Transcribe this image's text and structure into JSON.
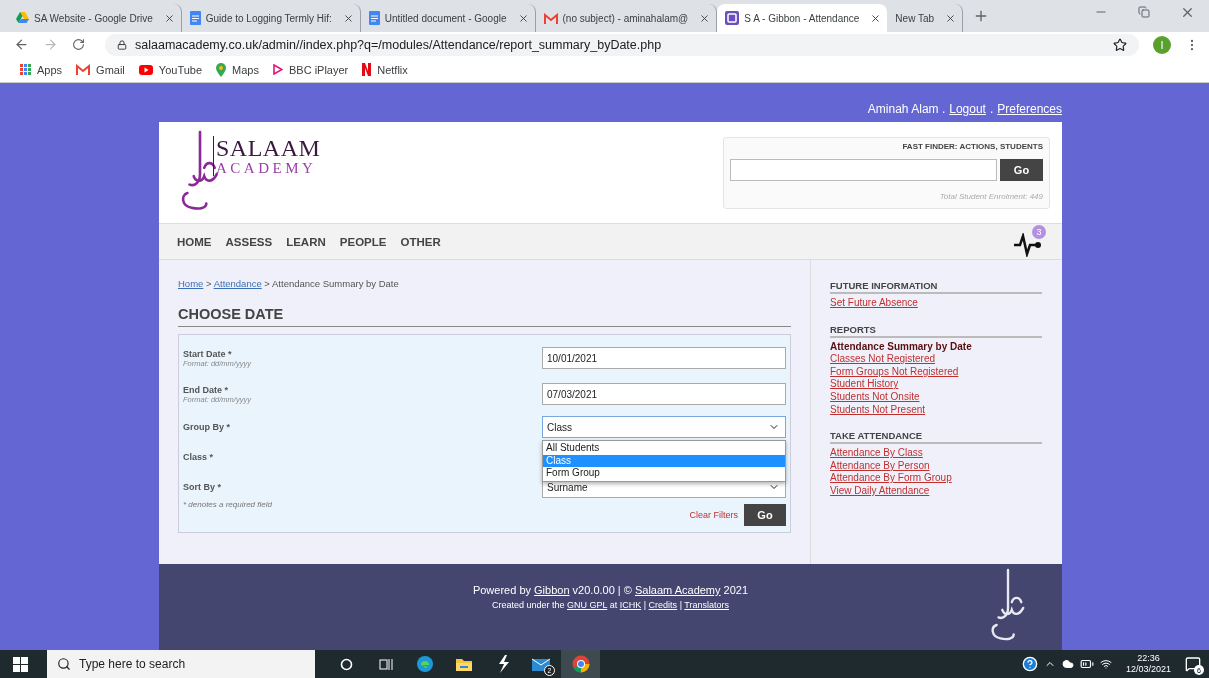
{
  "browser": {
    "tabs": [
      {
        "title": "SA Website - Google Drive",
        "kind": "drive",
        "selected": false
      },
      {
        "title": "Guide to Logging Termly Hif:",
        "kind": "docs",
        "selected": false
      },
      {
        "title": "Untitled document - Google",
        "kind": "docs",
        "selected": false
      },
      {
        "title": "(no subject) - aminahalam@",
        "kind": "gmail",
        "selected": false
      },
      {
        "title": "S A - Gibbon - Attendance",
        "kind": "gibbon",
        "selected": true
      },
      {
        "title": "New Tab",
        "kind": "blank",
        "selected": false
      }
    ],
    "address": "salaamacademy.co.uk/admin//index.php?q=/modules/Attendance/report_summary_byDate.php",
    "profile_initial": "I",
    "bookmarks": [
      {
        "label": "Apps",
        "kind": "apps"
      },
      {
        "label": "Gmail",
        "kind": "gmail"
      },
      {
        "label": "YouTube",
        "kind": "youtube"
      },
      {
        "label": "Maps",
        "kind": "maps"
      },
      {
        "label": "BBC iPlayer",
        "kind": "iplayer"
      },
      {
        "label": "Netflix",
        "kind": "netflix"
      }
    ]
  },
  "user_bar": {
    "name": "Aminah Alam",
    "separator": ".",
    "links": [
      "Logout",
      "Preferences"
    ]
  },
  "logo": {
    "line1": "SALAAM",
    "line2": "ACADEMY"
  },
  "fast_finder": {
    "title": "FAST FINDER: ACTIONS, STUDENTS",
    "button": "Go",
    "enrolment": "Total Student Enrolment: 449"
  },
  "nav": [
    "HOME",
    "ASSESS",
    "LEARN",
    "PEOPLE",
    "OTHER"
  ],
  "notification_count": "3",
  "breadcrumb": [
    {
      "text": "Home",
      "kind": "link"
    },
    {
      "text": " > ",
      "kind": "text"
    },
    {
      "text": "Attendance",
      "kind": "link"
    },
    {
      "text": " > Attendance Summary by Date",
      "kind": "text"
    }
  ],
  "heading": "CHOOSE DATE",
  "form": {
    "rows": [
      {
        "label": "Start Date *",
        "hint": "Format: dd/mm/yyyy",
        "kind": "text",
        "value": "10/01/2021"
      },
      {
        "label": "End Date *",
        "hint": "Format: dd/mm/yyyy",
        "kind": "text",
        "value": "07/03/2021"
      },
      {
        "label": "Group By *",
        "kind": "select",
        "value": "Class",
        "expanded": true,
        "options": [
          {
            "label": "All Students",
            "selected": false
          },
          {
            "label": "Class",
            "selected": true
          },
          {
            "label": "Form Group",
            "selected": false
          }
        ]
      },
      {
        "label": "Class *",
        "kind": "hidden"
      },
      {
        "label": "Sort By *",
        "kind": "select",
        "value": "Surname",
        "expanded": false
      }
    ],
    "note": "* denotes a required field",
    "clear": "Clear Filters",
    "submit": "Go"
  },
  "sidebar": [
    {
      "title": "FUTURE INFORMATION",
      "items": [
        {
          "label": "Set Future Absence",
          "current": false
        }
      ]
    },
    {
      "title": "REPORTS",
      "items": [
        {
          "label": "Attendance Summary by Date",
          "current": true
        },
        {
          "label": "Classes Not Registered",
          "current": false
        },
        {
          "label": "Form Groups Not Registered",
          "current": false
        },
        {
          "label": "Student History",
          "current": false
        },
        {
          "label": "Students Not Onsite",
          "current": false
        },
        {
          "label": "Students Not Present",
          "current": false
        }
      ]
    },
    {
      "title": "TAKE ATTENDANCE",
      "items": [
        {
          "label": "Attendance By Class",
          "current": false
        },
        {
          "label": "Attendance By Person",
          "current": false
        },
        {
          "label": "Attendance By Form Group",
          "current": false
        },
        {
          "label": "View Daily Attendance",
          "current": false
        }
      ]
    }
  ],
  "footer": {
    "lines": [
      [
        {
          "text": "Powered by ",
          "kind": "text"
        },
        {
          "text": "Gibbon",
          "kind": "link"
        },
        {
          "text": " v20.0.00 | © ",
          "kind": "text"
        },
        {
          "text": "Salaam Academy",
          "kind": "link"
        },
        {
          "text": " 2021",
          "kind": "text"
        }
      ],
      [
        {
          "text": "Created under the ",
          "kind": "text"
        },
        {
          "text": "GNU GPL",
          "kind": "link"
        },
        {
          "text": " at ",
          "kind": "text"
        },
        {
          "text": "ICHK",
          "kind": "link"
        },
        {
          "text": " | ",
          "kind": "text"
        },
        {
          "text": "Credits",
          "kind": "link"
        },
        {
          "text": " | ",
          "kind": "text"
        },
        {
          "text": "Translators",
          "kind": "link"
        }
      ]
    ]
  },
  "taskbar": {
    "search_placeholder": "Type here to search",
    "apps": [
      {
        "kind": "cortana",
        "active": false
      },
      {
        "kind": "taskview",
        "active": false
      },
      {
        "kind": "edge",
        "active": false
      },
      {
        "kind": "explorer",
        "active": false
      },
      {
        "kind": "bolt",
        "active": false
      },
      {
        "kind": "mail",
        "active": false,
        "badge": "2"
      },
      {
        "kind": "chrome",
        "active": true
      }
    ],
    "time": "22:36",
    "date": "12/03/2021",
    "notifications": "6"
  }
}
